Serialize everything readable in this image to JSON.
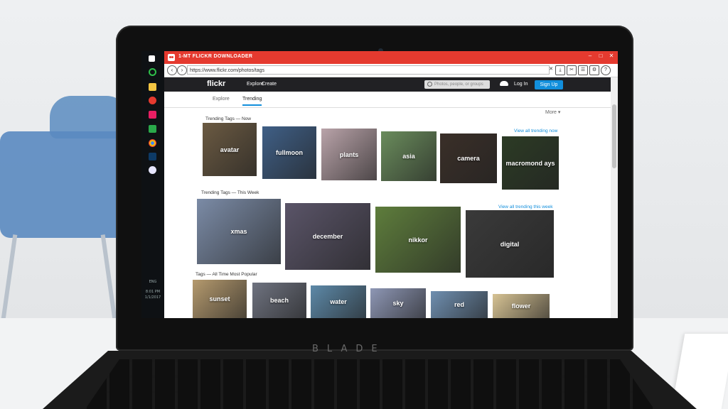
{
  "app": {
    "title": "1-MT FLICKR DOWNLOADER",
    "url": "https://www.flickr.com/photos/tags",
    "window_controls": [
      "–",
      "□",
      "✕"
    ]
  },
  "flickr": {
    "logo": "flickr",
    "nav": [
      "Explore",
      "Create"
    ],
    "search_placeholder": "Photos, people, or groups",
    "login": "Log In",
    "signup": "Sign Up",
    "subnav": [
      "Explore",
      "Trending"
    ],
    "more": "More ▾"
  },
  "sections": [
    {
      "title": "Trending Tags — Now",
      "view_all": "View all trending now",
      "tiles": [
        {
          "label": "avatar",
          "color": "#6b5a42"
        },
        {
          "label": "fullmoon",
          "color": "#3f5f86"
        },
        {
          "label": "plants",
          "color": "#b9a3a9"
        },
        {
          "label": "asia",
          "color": "#6a8c5c"
        },
        {
          "label": "camera",
          "color": "#3a2f28"
        },
        {
          "label": "macromond ays",
          "color": "#2c3b25"
        }
      ]
    },
    {
      "title": "Trending Tags — This Week",
      "view_all": "View all trending this week",
      "tiles": [
        {
          "label": "xmas",
          "color": "#7b8ba6"
        },
        {
          "label": "december",
          "color": "#5a5468"
        },
        {
          "label": "nikkor",
          "color": "#5e7d3c"
        },
        {
          "label": "digital",
          "color": "#3a3a3a"
        }
      ]
    },
    {
      "title": "Tags — All Time Most Popular",
      "tiles": [
        {
          "label": "sunset",
          "color": "#b59a6e"
        },
        {
          "label": "beach",
          "color": "#6f7380"
        },
        {
          "label": "water",
          "color": "#5d89a8"
        },
        {
          "label": "sky",
          "color": "#8e97b5"
        },
        {
          "label": "red",
          "color": "#6f8fb0"
        },
        {
          "label": "flower",
          "color": "#d7c394"
        }
      ]
    }
  ],
  "taskbar": {
    "lang": "ENG",
    "time": "8:01 PM",
    "date": "1/1/2017"
  },
  "laptop_brand": "BLADE"
}
